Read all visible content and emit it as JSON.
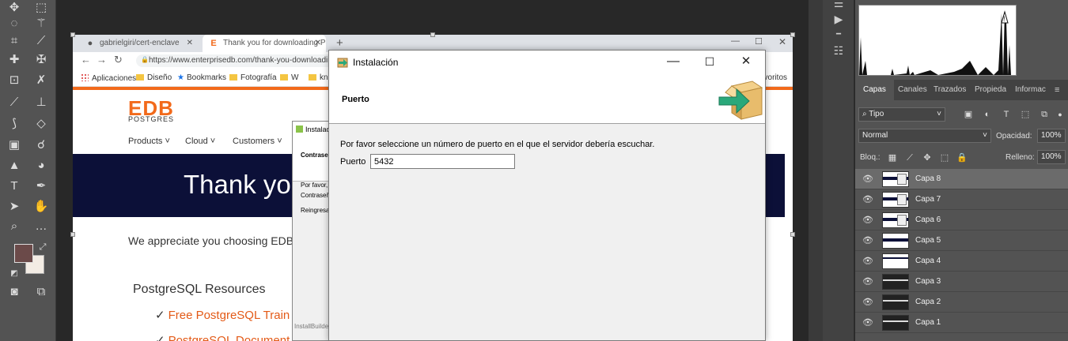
{
  "photoshop": {
    "tools": [
      "move-tool",
      "marquee-tool",
      "lasso-tool",
      "magic-wand-tool",
      "crop-tool",
      "eyedropper-tool",
      "healing-tool",
      "patch-tool",
      "brush-tool",
      "stamp-tool",
      "history-brush-tool",
      "eraser-tool",
      "gradient-tool",
      "smudge-tool",
      "shape-tool",
      "dodge-tool",
      "type-tool",
      "pen-tool",
      "path-select-tool",
      "hand-tool",
      "zoom-tool",
      "more-tools",
      "quickmask-tool",
      "screenmode-tool"
    ],
    "colors": {
      "foreground": "#6b4a49",
      "background": "#f3ece4"
    },
    "panel_tabs": [
      "Capas",
      "Canales",
      "Trazados",
      "Propieda",
      "Informac"
    ],
    "active_panel_tab": "Capas",
    "filter_kind": "Tipo",
    "blend_mode": "Normal",
    "opacity_label": "Opacidad:",
    "opacity_value": "100%",
    "lock_label": "Bloq.:",
    "fill_label": "Relleno:",
    "fill_value": "100%",
    "layers": [
      "Capa 8",
      "Capa 7",
      "Capa 6",
      "Capa 5",
      "Capa 4",
      "Capa 3",
      "Capa 2",
      "Capa 1"
    ],
    "selected_layer": "Capa 8"
  },
  "browser": {
    "tab1_title": "gabrielgiri/cert-enclave",
    "tab2_title": "Thank you for downloading Post",
    "url": "https://www.enterprisedb.com/thank-you-downloading",
    "bookmarks": [
      "Aplicaciones",
      "Diseño",
      "Bookmarks",
      "Fotografía",
      "W",
      "kn"
    ],
    "bookmarks_extra": "avoritos"
  },
  "page": {
    "logo": "EDB",
    "logo_sub": "POSTGRES",
    "nav": [
      "Products",
      "Cloud",
      "Customers"
    ],
    "hero": "Thank yo",
    "appreciate": "We appreciate you choosing EDB a",
    "resources_title": "PostgreSQL Resources",
    "resource_links": [
      "Free PostgreSQL Train",
      "PostgreSQL Document"
    ]
  },
  "installer_back": {
    "title": "Instalació",
    "heading": "Contraseñ",
    "line1": "Por favor, p",
    "line2": "Contraseñ",
    "line3": "Reingresar",
    "footer": "InstallBuilder"
  },
  "installer": {
    "title": "Instalación",
    "heading": "Puerto",
    "prompt": "Por favor seleccione un número de puerto en el que el servidor debería escuchar.",
    "port_label": "Puerto",
    "port_value": "5432",
    "minimize": "—",
    "maximize": "☐",
    "close": "✕"
  }
}
